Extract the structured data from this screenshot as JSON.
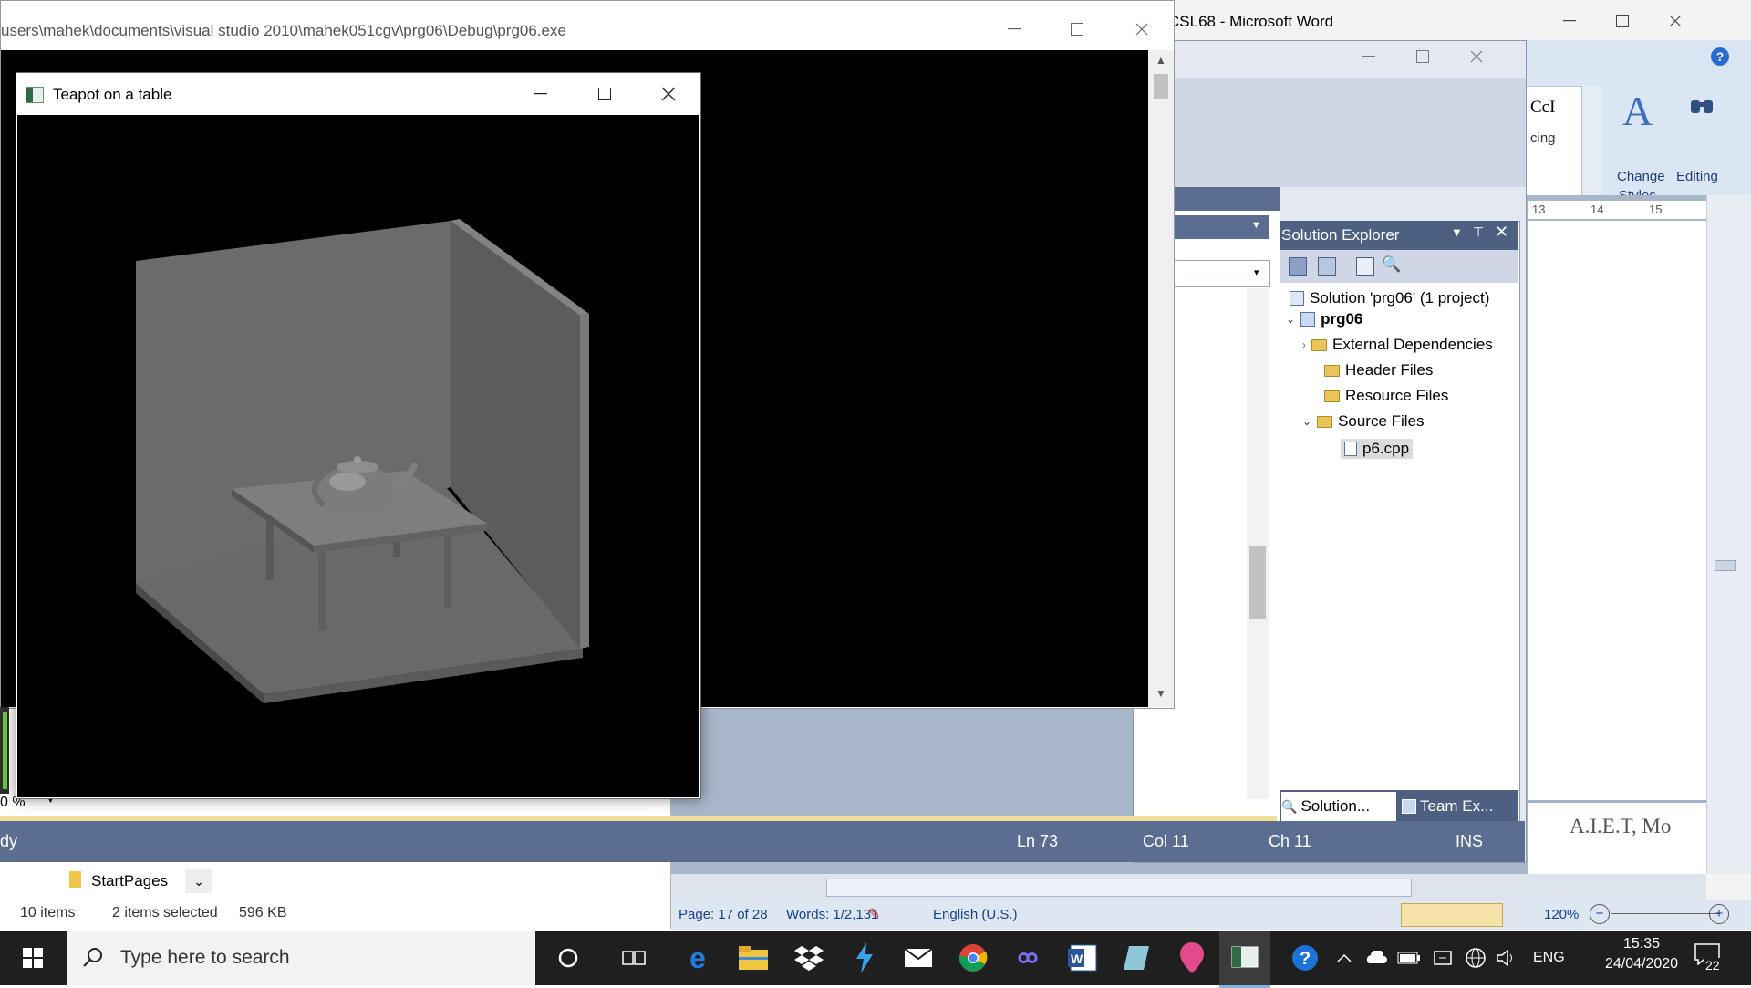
{
  "word": {
    "title": "CSL68 - Microsoft Word",
    "ribbon": {
      "styles_partial_1": "CcI",
      "styles_partial_2": "cing",
      "change_styles_line1": "Change",
      "change_styles_line2": "Styles",
      "editing_label": "Editing"
    },
    "ruler": [
      "13",
      "14",
      "15"
    ],
    "doc_text": "A.I.E.T, Mo",
    "status": {
      "page": "Page: 17 of 28",
      "words": "Words: 1/2,131",
      "language": "English (U.S.)",
      "zoom": "120%"
    }
  },
  "vs": {
    "solution_explorer": {
      "title": "Solution Explorer",
      "solution": "Solution 'prg06' (1 project)",
      "project": "prg06",
      "items": [
        "External Dependencies",
        "Header Files",
        "Resource Files",
        "Source Files"
      ],
      "file": "p6.cpp",
      "tabs": [
        "Solution...",
        "Team Ex..."
      ]
    },
    "zoom_partial": "0 %",
    "status": {
      "left": "dy",
      "ln": "Ln 73",
      "col": "Col 11",
      "ch": "Ch 11",
      "mode": "INS"
    }
  },
  "console": {
    "title": "users\\mahek\\documents\\visual studio 2010\\mahek051cgv\\prg06\\Debug\\prg06.exe"
  },
  "gl_window": {
    "title": "Teapot on a table"
  },
  "explorer": {
    "breadcrumb": "StartPages",
    "item_count": "10 items",
    "selection": "2 items selected",
    "size": "596 KB"
  },
  "taskbar": {
    "search_placeholder": "Type here to search",
    "language": "ENG",
    "time": "15:35",
    "date": "24/04/2020",
    "notifications": "22"
  },
  "colors": {
    "vs_status": "#5b6e92",
    "se_header": "#4d6082",
    "taskbar": "#1f1f1f",
    "word_page": "#ffffff",
    "scene_gray": "#6e6e6e"
  }
}
